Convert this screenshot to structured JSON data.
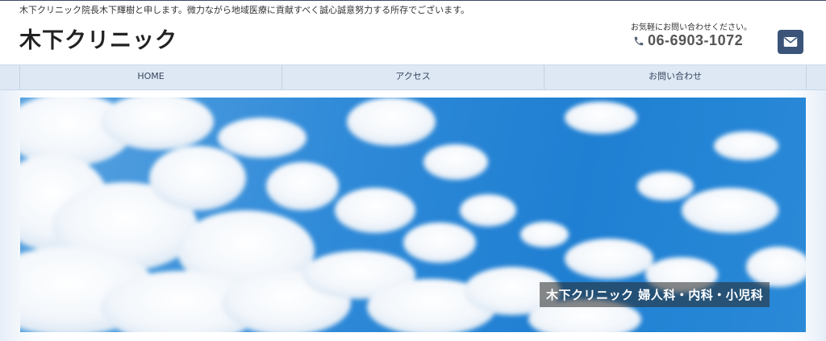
{
  "tagline": "木下クリニック院長木下輝樹と申します。微力ながら地域医療に貢献すべく誠心誠意努力する所存でございます。",
  "header": {
    "site_title": "木下クリニック",
    "contact_note": "お気軽にお問い合わせください。",
    "phone_number": "06-6903-1072",
    "phone_icon": "phone-icon",
    "mail_icon": "mail-icon"
  },
  "nav": {
    "items": [
      {
        "label": "HOME"
      },
      {
        "label": "アクセス"
      },
      {
        "label": "お問い合わせ"
      }
    ]
  },
  "hero": {
    "caption": "木下クリニック 婦人科・内科・小児科"
  },
  "colors": {
    "accent": "#3b5478",
    "nav_bg": "#dde8f4",
    "sky": "#1f7fd2"
  }
}
